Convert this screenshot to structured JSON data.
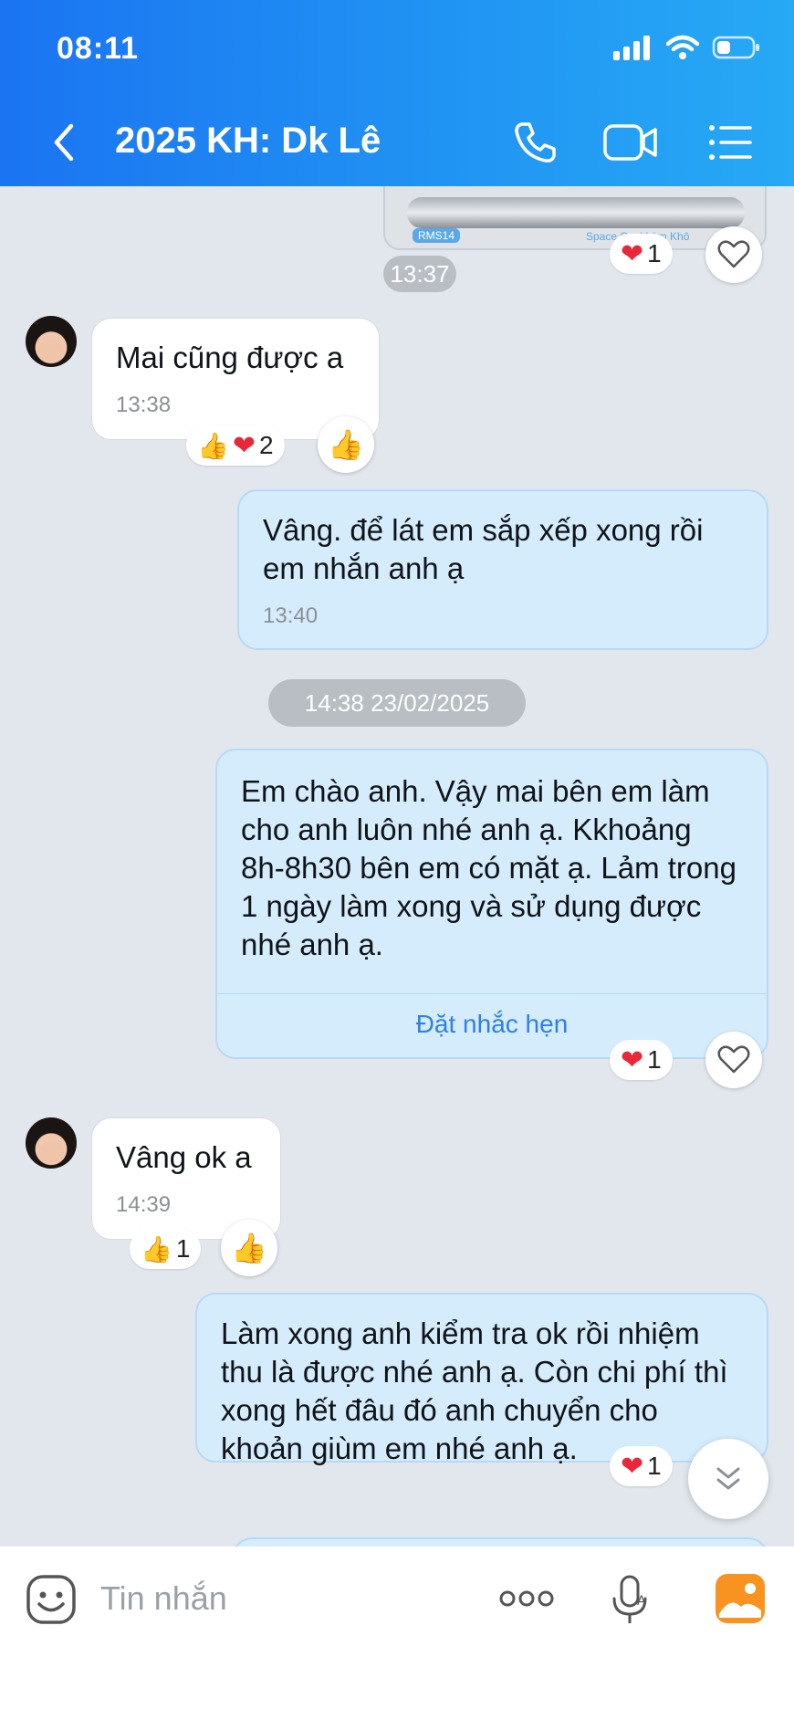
{
  "status": {
    "time": "08:11"
  },
  "header": {
    "title": "2025 KH: Dk Lê"
  },
  "messages": {
    "m0": {
      "time": "13:37",
      "heart_count": "1"
    },
    "m1": {
      "text": "Mai cũng được a",
      "time": "13:38",
      "reaction_count": "2"
    },
    "m2": {
      "text": "Vâng. để lát em sắp xếp xong rồi em nhắn anh ạ",
      "time": "13:40"
    },
    "divider": "14:38 23/02/2025",
    "m3": {
      "text": "Em chào anh. Vậy mai bên em làm cho anh luôn nhé anh ạ. Kkhoảng 8h-8h30 bên em có mặt ạ. Lảm trong 1 ngày làm xong và sử dụng được nhé anh ạ.",
      "reminder": "Đặt nhắc hẹn",
      "heart_count": "1"
    },
    "m4": {
      "text": "Vâng ok a",
      "time": "14:39",
      "like_count": "1"
    },
    "m5": {
      "text": "Làm xong anh kiểm tra ok rồi nhiệm thu là được nhé anh ạ. Còn chi phí thì xong hết đâu đó anh chuyển cho khoản giùm em nhé anh ạ.",
      "heart_count": "1"
    }
  },
  "image_labels": {
    "left": "RMS14",
    "right": "Space Cool Làm Khô"
  },
  "composer": {
    "placeholder": "Tin nhắn"
  },
  "colors": {
    "header": "#1b74f2",
    "outgoing": "#d5ecfd",
    "accent": "#2f80e3",
    "heart": "#e8283a"
  },
  "icons": [
    "back-icon",
    "phone-icon",
    "video-call-icon",
    "menu-list-icon",
    "heart-icon",
    "thumbs-up-icon",
    "sticker-icon",
    "more-icon",
    "voice-icon",
    "image-icon",
    "chevron-down-icon"
  ]
}
